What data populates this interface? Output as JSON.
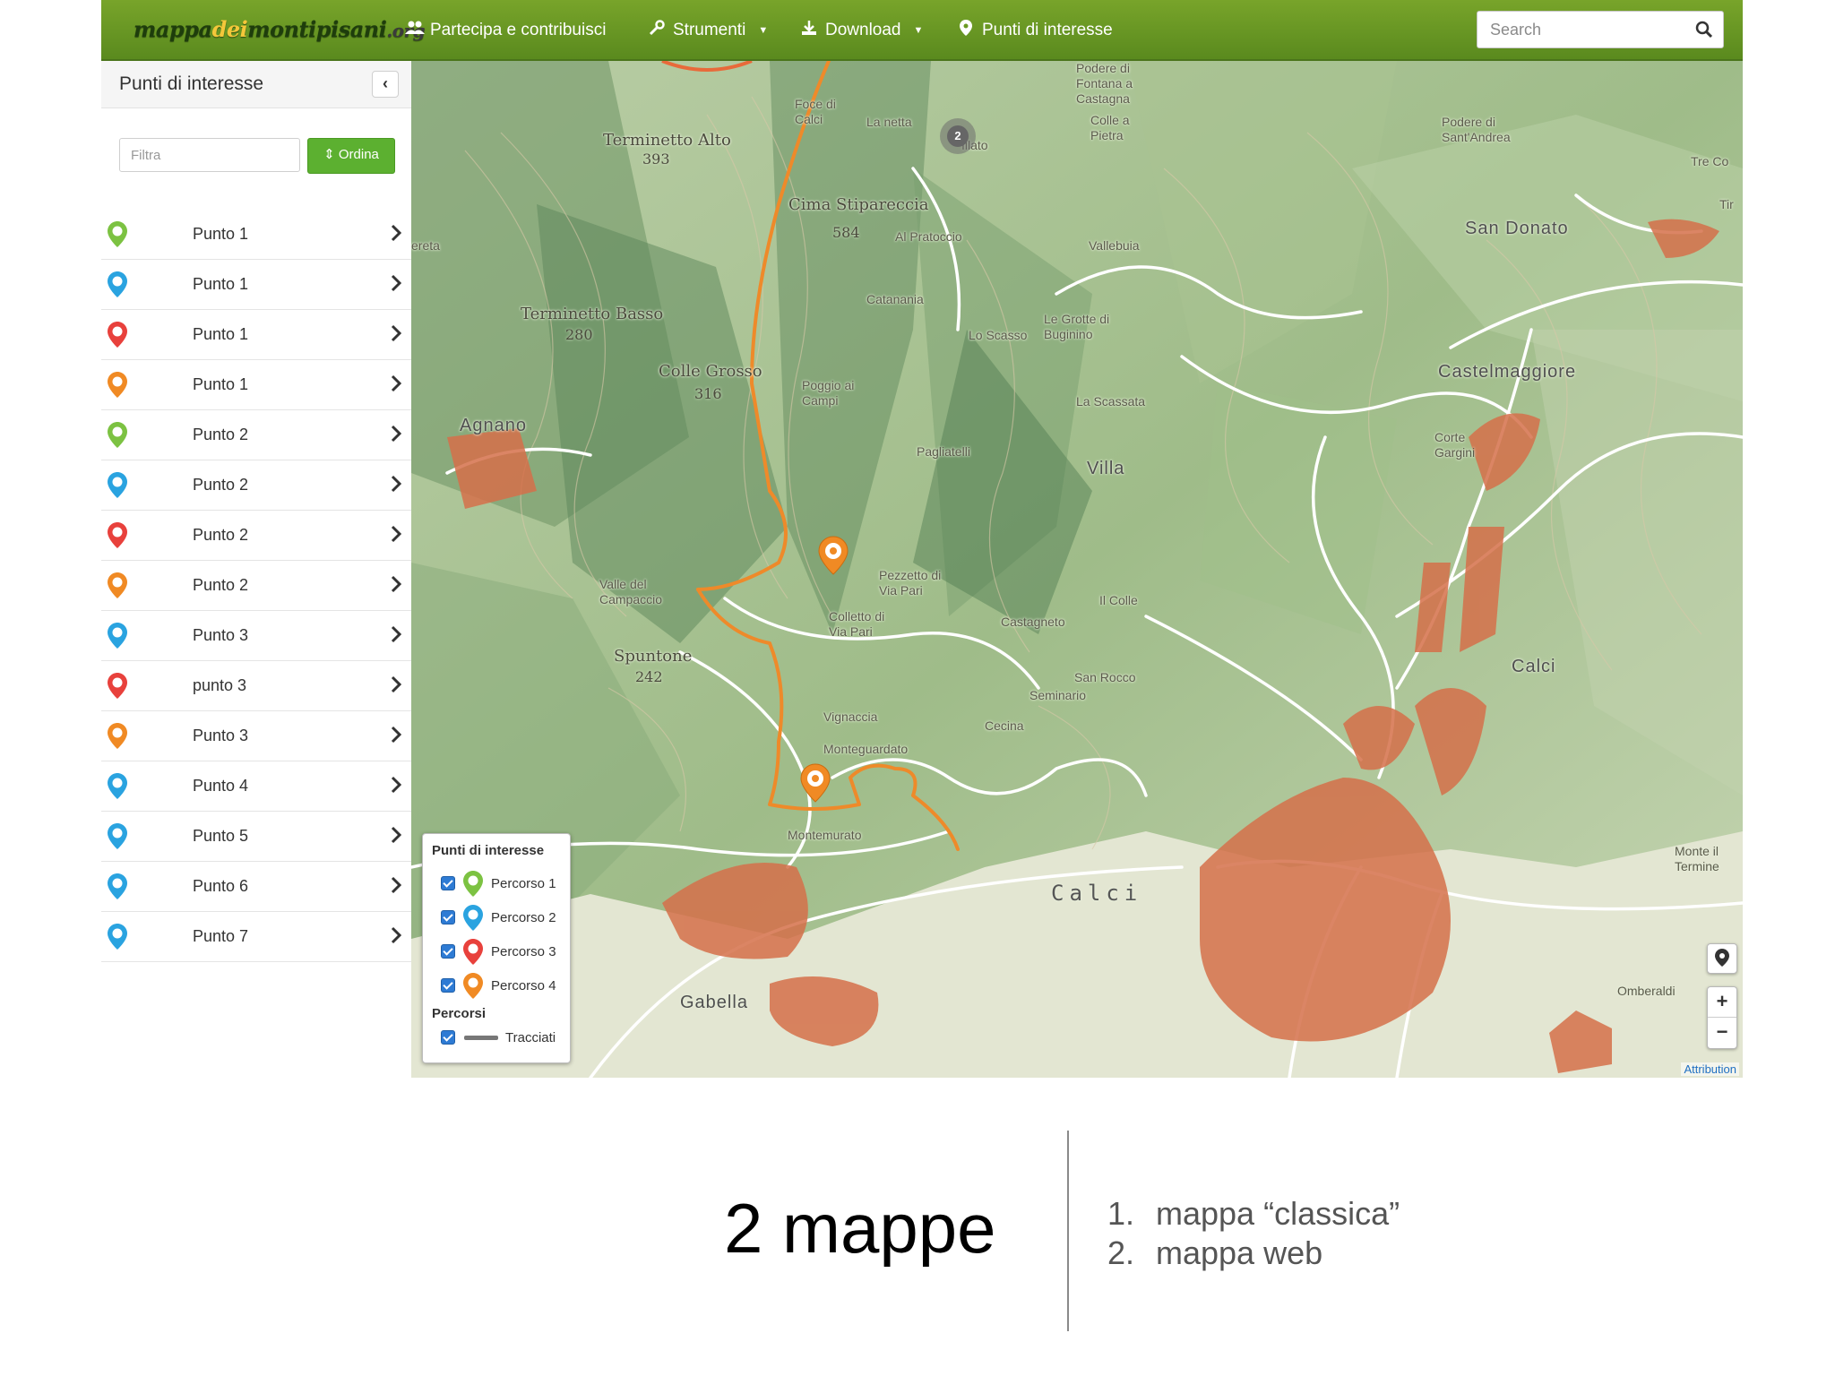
{
  "navbar": {
    "logo": {
      "part1": "mappa",
      "part2": "dei",
      "part3": "montipisani",
      "part4": ".org"
    },
    "items": [
      {
        "label": "Partecipa e contribuisci",
        "icon": "users-icon"
      },
      {
        "label": "Strumenti",
        "icon": "wrench-icon",
        "dropdown": true
      },
      {
        "label": "Download",
        "icon": "download-icon",
        "dropdown": true
      },
      {
        "label": "Punti di interesse",
        "icon": "map-marker-icon"
      }
    ],
    "search": {
      "placeholder": "Search"
    }
  },
  "sidebar": {
    "title": "Punti di interesse",
    "filter_placeholder": "Filtra",
    "sort_label": "Ordina",
    "items": [
      {
        "label": "Punto 1",
        "color": "#7cc242"
      },
      {
        "label": "Punto 1",
        "color": "#2aa3e0"
      },
      {
        "label": "Punto 1",
        "color": "#e8413c"
      },
      {
        "label": "Punto 1",
        "color": "#f08a24"
      },
      {
        "label": "Punto 2",
        "color": "#7cc242"
      },
      {
        "label": "Punto 2",
        "color": "#2aa3e0"
      },
      {
        "label": "Punto 2",
        "color": "#e8413c"
      },
      {
        "label": "Punto 2",
        "color": "#f08a24"
      },
      {
        "label": "Punto 3",
        "color": "#2aa3e0"
      },
      {
        "label": "punto 3",
        "color": "#e8413c"
      },
      {
        "label": "Punto 3",
        "color": "#f08a24"
      },
      {
        "label": "Punto 4",
        "color": "#2aa3e0"
      },
      {
        "label": "Punto 5",
        "color": "#2aa3e0"
      },
      {
        "label": "Punto 6",
        "color": "#2aa3e0"
      },
      {
        "label": "Punto 7",
        "color": "#2aa3e0"
      }
    ]
  },
  "map": {
    "places": {
      "terminetto_alto": "Terminetto Alto",
      "terminetto_alto_elev": "393",
      "terminetto_basso": "Terminetto Basso",
      "terminetto_basso_elev": "280",
      "cima_stipareccia": "Cima Stipareccia",
      "cima_stipareccia_elev": "584",
      "colle_grosso": "Colle Grosso",
      "colle_grosso_elev": "316",
      "spuntone": "Spuntone",
      "spuntone_elev": "242",
      "agnano": "Agnano",
      "calci": "Calci",
      "calci_town": "Calci",
      "gabella": "Gabella",
      "san_donato": "San Donato",
      "castelmaggiore": "Castelmaggiore",
      "villa": "Villa",
      "la_netta": "La netta",
      "al_pratoccio": "Al Pratoccio",
      "catanania": "Catanania",
      "vallebuia": "Vallebuia",
      "lo_scasso": "Lo Scasso",
      "le_grotte": "Le Grotte di Buginino",
      "poggio_ai_campi": "Poggio ai Campi",
      "la_scassata": "La Scassata",
      "pagliatelli": "Pagliatelli",
      "valle_del_campaccio": "Valle del Campaccio",
      "pezzetto": "Pezzetto di Via Pari",
      "colletto": "Colletto di Via Pari",
      "castagneto": "Castagneto",
      "il_colle": "Il Colle",
      "san_rocco": "San Rocco",
      "seminario": "Seminario",
      "cecina": "Cecina",
      "vignaccia": "Vignaccia",
      "monteguardato": "Monteguardato",
      "montemurato": "Montemurato",
      "foce": "Foce di Calci",
      "illato": "Illato",
      "podere_fontana": "Podere di Fontana a Castagna",
      "colle_pietra": "Colle a Pietra",
      "podere_sant_andrea": "Podere di Sant'Andrea",
      "monte_termine": "Monte il Termine",
      "omberaldi": "Omberaldi",
      "corte_gargini": "Corte Gargini",
      "tre_co": "Tre Co",
      "tir": "Tir",
      "ereta": "ereta"
    },
    "cluster_count": "2",
    "legend": {
      "title": "Punti di interesse",
      "items": [
        {
          "label": "Percorso 1",
          "color": "#7cc242"
        },
        {
          "label": "Percorso 2",
          "color": "#2aa3e0"
        },
        {
          "label": "Percorso 3",
          "color": "#e8413c"
        },
        {
          "label": "Percorso 4",
          "color": "#f08a24"
        }
      ],
      "tracks_title": "Percorsi",
      "tracks_label": "Tracciati"
    },
    "zoom_in": "+",
    "zoom_out": "−",
    "attribution": "Attribution",
    "route_color": "#f08a24"
  },
  "slide": {
    "title": "2 mappe",
    "list": [
      {
        "num": "1.",
        "text": "mappa “classica”"
      },
      {
        "num": "2.",
        "text": "mappa web"
      }
    ]
  }
}
